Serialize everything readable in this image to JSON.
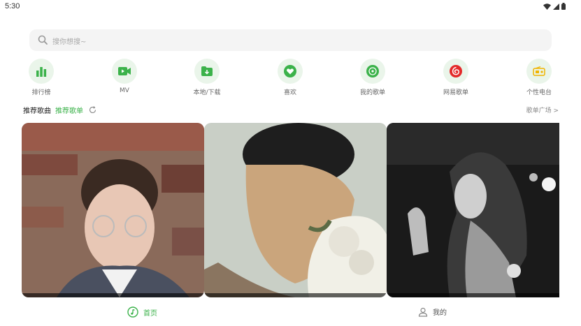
{
  "status_bar": {
    "time": "5:30"
  },
  "search": {
    "placeholder": "搜你想搜~"
  },
  "quick_access": [
    {
      "label": "排行榜",
      "icon": "chart-bars-icon"
    },
    {
      "label": "MV",
      "icon": "video-icon"
    },
    {
      "label": "本地/下载",
      "icon": "download-folder-icon"
    },
    {
      "label": "喜欢",
      "icon": "heart-icon"
    },
    {
      "label": "我的歌单",
      "icon": "disc-icon"
    },
    {
      "label": "网易歌单",
      "icon": "netease-icon"
    },
    {
      "label": "个性电台",
      "icon": "radio-icon"
    }
  ],
  "section": {
    "tab_songs": "推荐歌曲",
    "tab_playlists": "推荐歌单",
    "more": "歌单广场 >"
  },
  "nav": {
    "home": "首页",
    "mine": "我的"
  },
  "colors": {
    "accent": "#3bb24a",
    "icon_bg": "#eaf5ea",
    "search_bg": "#f4f4f4"
  }
}
